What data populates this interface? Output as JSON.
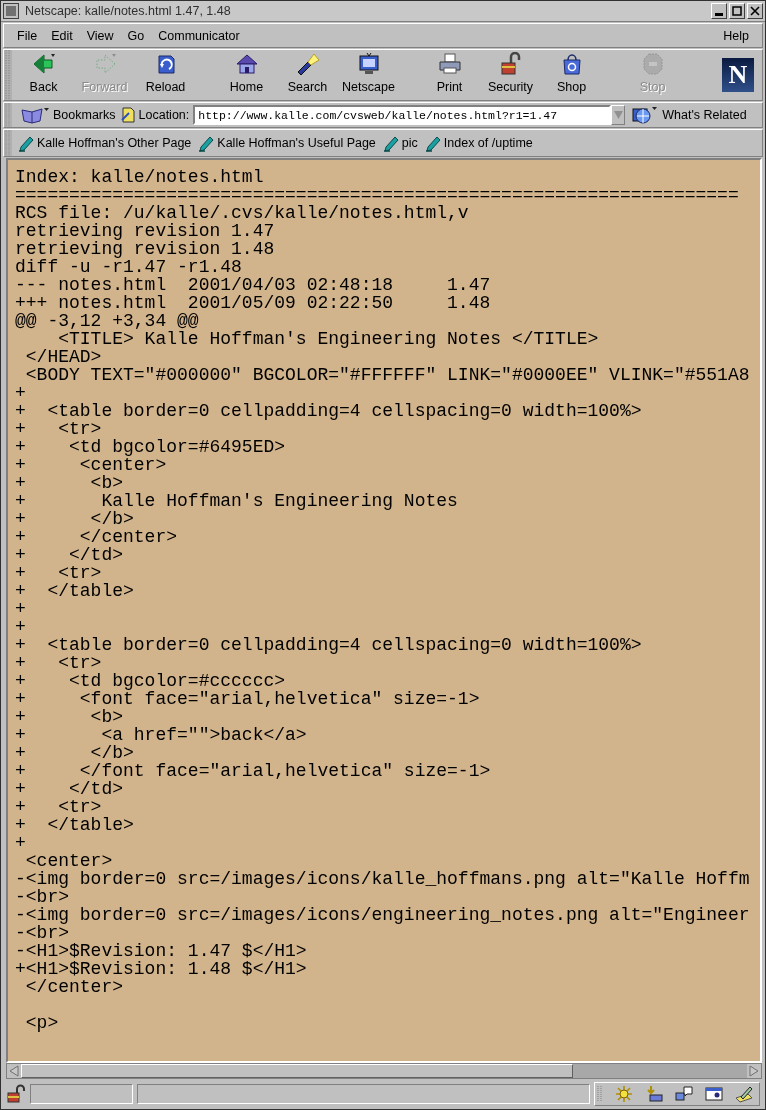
{
  "window": {
    "title": "Netscape: kalle/notes.html 1.47, 1.48"
  },
  "menu": {
    "left": [
      "File",
      "Edit",
      "View",
      "Go",
      "Communicator"
    ],
    "right": [
      "Help"
    ]
  },
  "toolbar": {
    "groups": [
      [
        {
          "label": "Back",
          "disabled": false
        },
        {
          "label": "Forward",
          "disabled": true
        },
        {
          "label": "Reload",
          "disabled": false
        }
      ],
      [
        {
          "label": "Home",
          "disabled": false
        },
        {
          "label": "Search",
          "disabled": false
        },
        {
          "label": "Netscape",
          "disabled": false
        }
      ],
      [
        {
          "label": "Print",
          "disabled": false
        },
        {
          "label": "Security",
          "disabled": false
        },
        {
          "label": "Shop",
          "disabled": false
        }
      ],
      [
        {
          "label": "Stop",
          "disabled": true
        }
      ]
    ],
    "logo": "N"
  },
  "location_bar": {
    "bookmarks": "Bookmarks",
    "location_label": "Location:",
    "url": "http://www.kalle.com/cvsweb/kalle/notes.html?r1=1.47",
    "related": "What's Related"
  },
  "personal_toolbar": [
    "Kalle Hoffman's Other Page",
    "Kalle Hoffman's Useful Page",
    "pic",
    "Index of /uptime"
  ],
  "source": [
    {
      "kind": "line",
      "text": "Index: kalle/notes.html"
    },
    {
      "kind": "line",
      "text": "==================================================================="
    },
    {
      "kind": "line",
      "text": "RCS file: /u/kalle/.cvs/kalle/notes.html,v"
    },
    {
      "kind": "line",
      "text": "retrieving revision 1.47"
    },
    {
      "kind": "line",
      "text": "retrieving revision 1.48"
    },
    {
      "kind": "line",
      "text": "diff -u -r1.47 -r1.48"
    },
    {
      "kind": "line",
      "text": "--- notes.html  2001/04/03 02:48:18     1.47"
    },
    {
      "kind": "line",
      "text": "+++ notes.html  2001/05/09 02:22:50     1.48"
    },
    {
      "kind": "line",
      "text": "@@ -3,12 +3,34 @@"
    },
    {
      "kind": "line",
      "text": "    <TITLE> Kalle Hoffman's Engineering Notes </TITLE>"
    },
    {
      "kind": "line",
      "text": " </HEAD>"
    },
    {
      "kind": "line",
      "text": " <BODY TEXT=\"#000000\" BGCOLOR=\"#FFFFFF\" LINK=\"#0000EE\" VLINK=\"#551A8"
    },
    {
      "kind": "line",
      "text": "+"
    },
    {
      "kind": "line",
      "text": "+  <table border=0 cellpadding=4 cellspacing=0 width=100%>"
    },
    {
      "kind": "line",
      "text": "+   <tr>"
    },
    {
      "kind": "line",
      "text": "+    <td bgcolor=#6495ED>"
    },
    {
      "kind": "line",
      "text": "+     <center>"
    },
    {
      "kind": "line",
      "text": "+      <b>"
    },
    {
      "kind": "line",
      "text": "+       Kalle Hoffman's Engineering Notes"
    },
    {
      "kind": "line",
      "text": "+      </b>"
    },
    {
      "kind": "line",
      "text": "+     </center>"
    },
    {
      "kind": "line",
      "text": "+    </td>"
    },
    {
      "kind": "line",
      "text": "+   <tr>"
    },
    {
      "kind": "line",
      "text": "+  </table>"
    },
    {
      "kind": "line",
      "text": "+"
    },
    {
      "kind": "line",
      "text": "+"
    },
    {
      "kind": "line",
      "text": "+  <table border=0 cellpadding=4 cellspacing=0 width=100%>"
    },
    {
      "kind": "line",
      "text": "+   <tr>"
    },
    {
      "kind": "line",
      "text": "+    <td bgcolor=#cccccc>"
    },
    {
      "kind": "line",
      "text": "+     <font face=\"arial,helvetica\" size=-1>"
    },
    {
      "kind": "line",
      "text": "+      <b>"
    },
    {
      "kind": "line",
      "text": "+       <a href=\"\">back</a>"
    },
    {
      "kind": "line",
      "text": "+      </b>"
    },
    {
      "kind": "line",
      "text": "+     </font face=\"arial,helvetica\" size=-1>"
    },
    {
      "kind": "line",
      "text": "+    </td>"
    },
    {
      "kind": "line",
      "text": "+   <tr>"
    },
    {
      "kind": "line",
      "text": "+  </table>"
    },
    {
      "kind": "line",
      "text": "+"
    },
    {
      "kind": "line",
      "text": " <center>"
    },
    {
      "kind": "line",
      "text": "-<img border=0 src=/images/icons/kalle_hoffmans.png alt=\"Kalle Hoffm"
    },
    {
      "kind": "line",
      "text": "-<br>"
    },
    {
      "kind": "line",
      "text": "-<img border=0 src=/images/icons/engineering_notes.png alt=\"Engineer"
    },
    {
      "kind": "line",
      "text": "-<br>"
    },
    {
      "kind": "line",
      "text": "-<H1>$Revision: 1.47 $</H1>"
    },
    {
      "kind": "line",
      "text": "+<H1>$Revision: 1.48 $</H1>"
    },
    {
      "kind": "line",
      "text": " </center>"
    },
    {
      "kind": "blank"
    },
    {
      "kind": "line",
      "text": " <p>"
    }
  ]
}
